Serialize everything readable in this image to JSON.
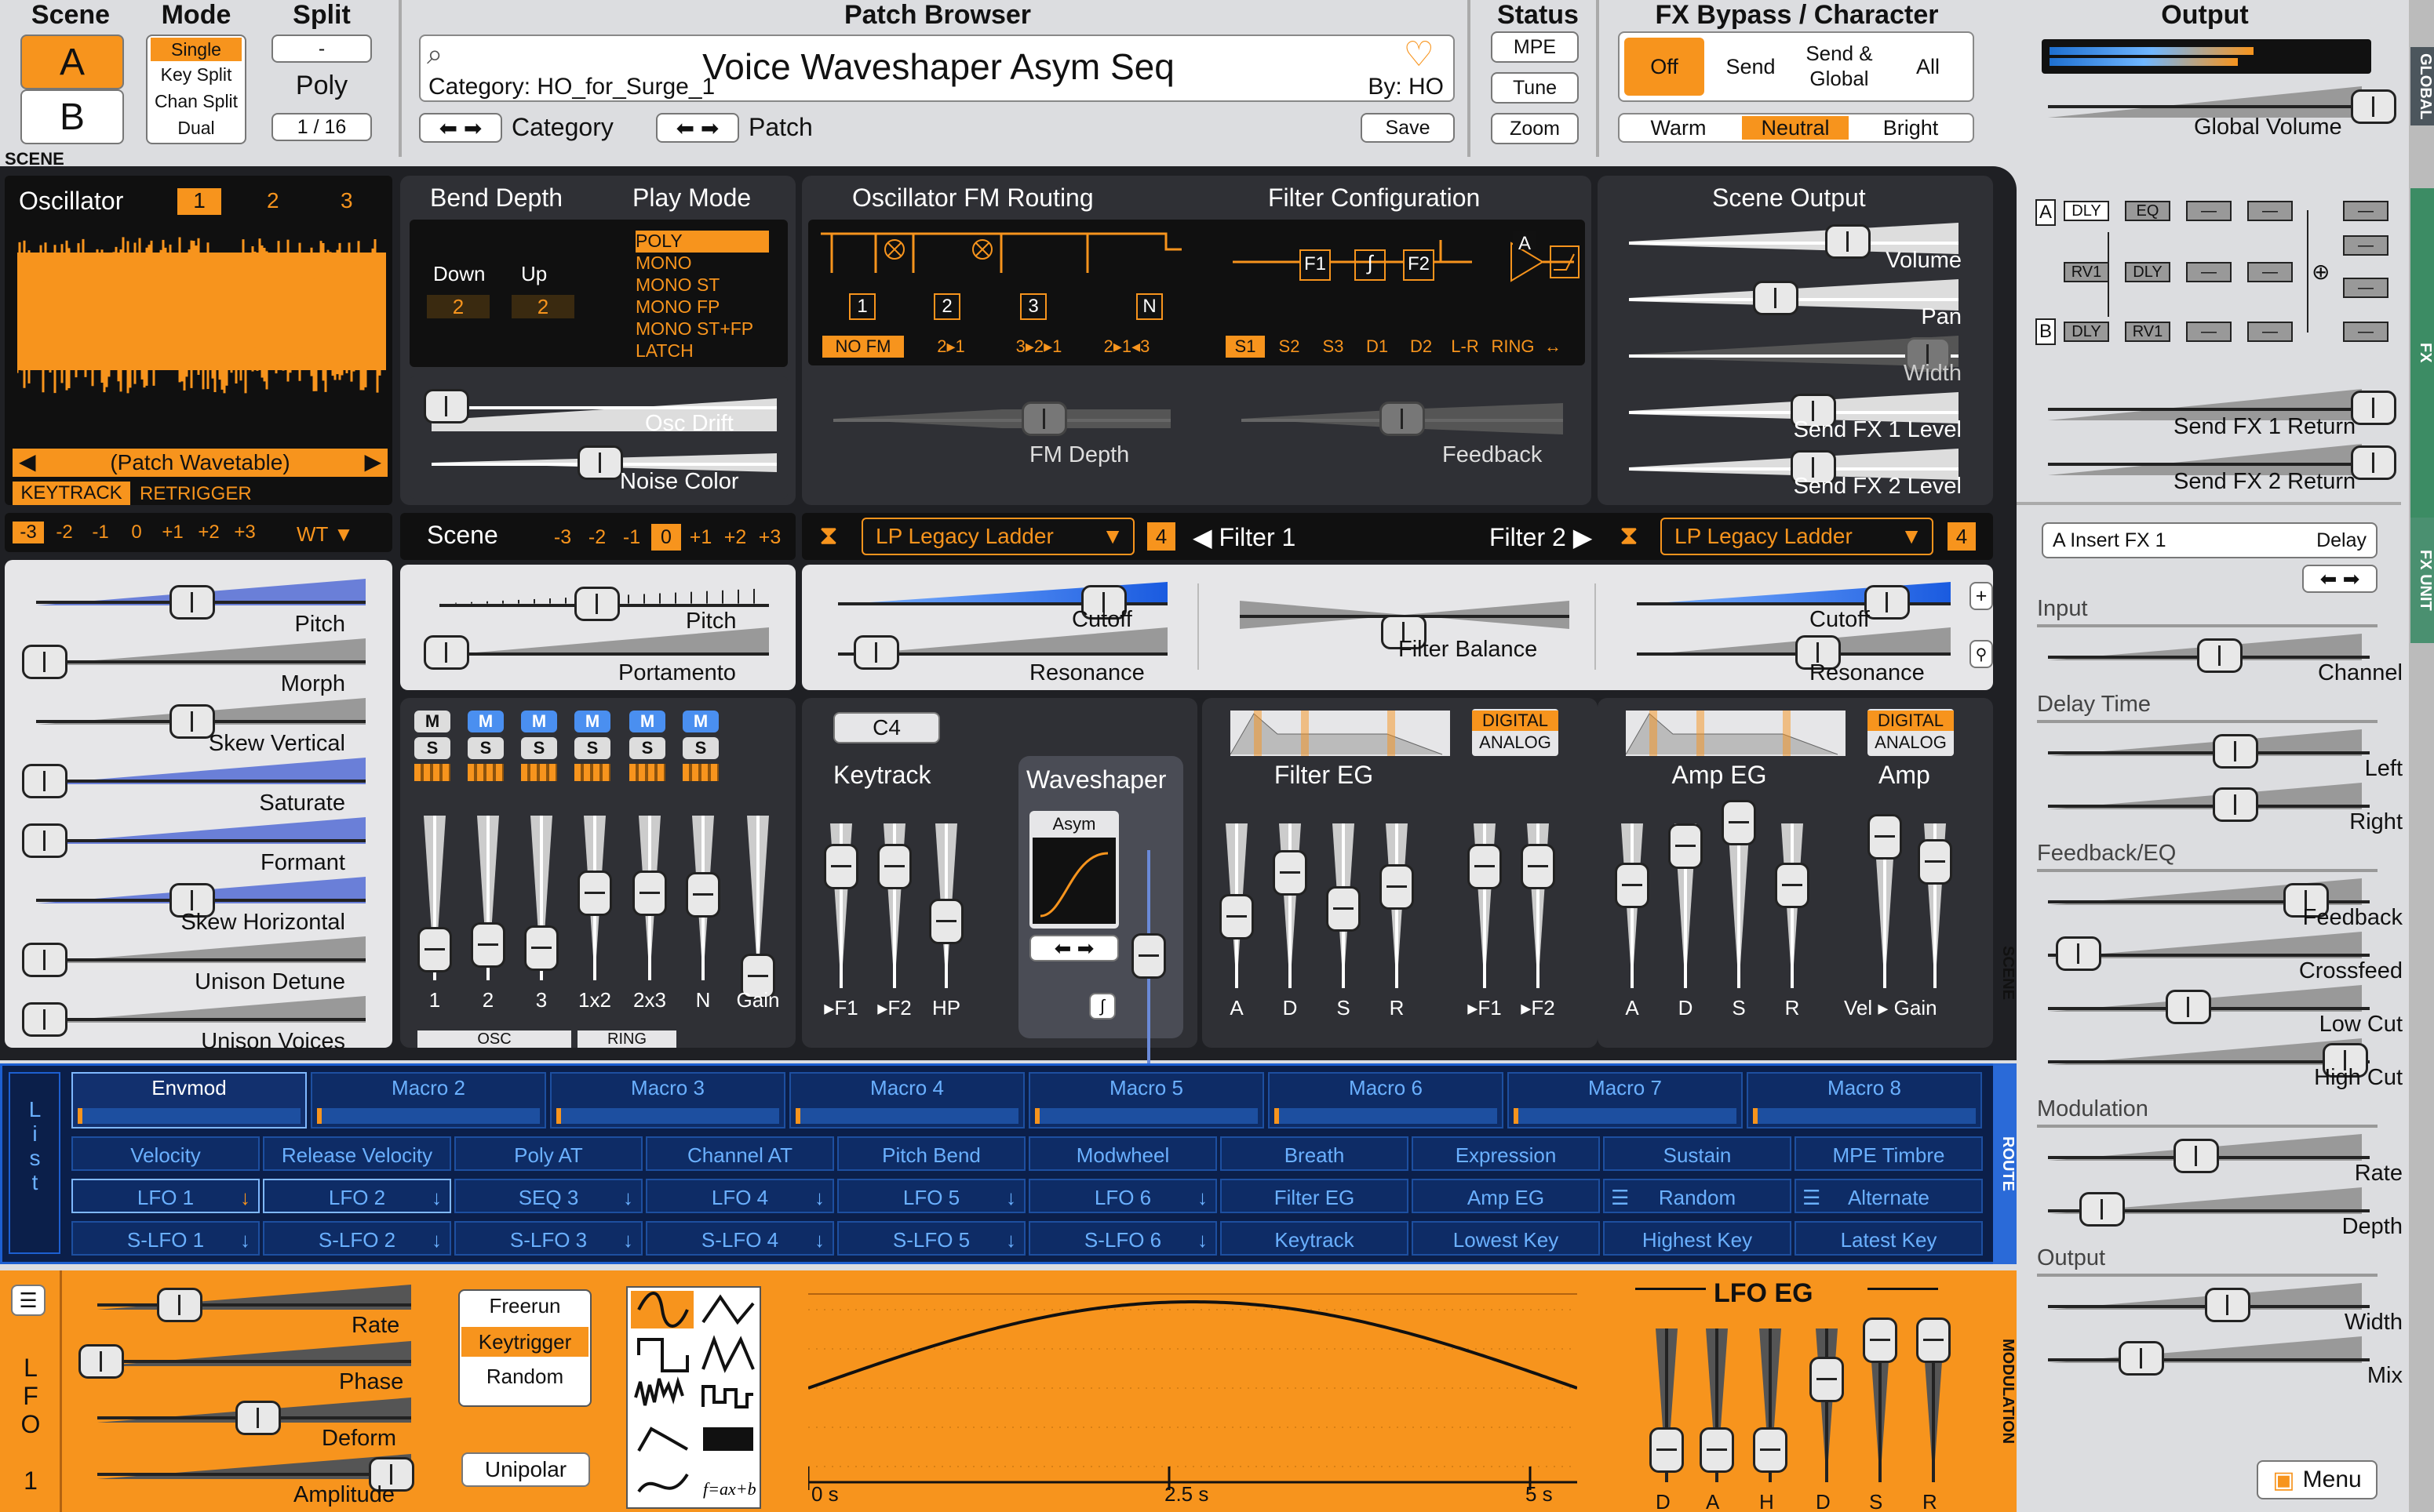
{
  "top": {
    "scene": {
      "title": "Scene",
      "a": "A",
      "b": "B"
    },
    "mode": {
      "title": "Mode",
      "options": [
        "Single",
        "Key Split",
        "Chan Split",
        "Dual"
      ],
      "selected": "Single"
    },
    "split": {
      "title": "Split",
      "value": "-",
      "poly_label": "Poly",
      "poly_value": "1 / 16"
    },
    "browser": {
      "title": "Patch Browser",
      "patch_name": "Voice Waveshaper Asym Seq",
      "category": "Category: HO_for_Surge_1",
      "author": "By: HO",
      "category_label": "Category",
      "patch_label": "Patch",
      "save": "Save"
    },
    "status": {
      "title": "Status",
      "mpe": "MPE",
      "tune": "Tune",
      "zoom": "Zoom"
    },
    "fx": {
      "title": "FX Bypass / Character",
      "off": "Off",
      "send": "Send",
      "send_global": "Send & Global",
      "all": "All",
      "warm": "Warm",
      "neutral": "Neutral",
      "bright": "Bright"
    },
    "output": {
      "title": "Output",
      "global_volume": "Global Volume"
    }
  },
  "scene_label": "SCENE",
  "osc": {
    "title": "Oscillator",
    "tabs": [
      "1",
      "2",
      "3"
    ],
    "wavetable": "(Patch Wavetable)",
    "keytrack": "KEYTRACK",
    "retrigger": "RETRIGGER",
    "octaves": [
      "-3",
      "-2",
      "-1",
      "0",
      "+1",
      "+2",
      "+3"
    ],
    "type": "WT",
    "params": [
      "Pitch",
      "Morph",
      "Skew Vertical",
      "Saturate",
      "Formant",
      "Skew Horizontal",
      "Unison Detune",
      "Unison Voices"
    ]
  },
  "bend": {
    "title": "Bend Depth",
    "down": "Down",
    "up": "Up",
    "down_val": "2",
    "up_val": "2"
  },
  "playmode": {
    "title": "Play Mode",
    "options": [
      "POLY",
      "MONO",
      "MONO ST",
      "MONO FP",
      "MONO ST+FP",
      "LATCH"
    ]
  },
  "drift": {
    "osc_drift": "Osc Drift",
    "noise_color": "Noise Color"
  },
  "fm": {
    "title": "Oscillator FM Routing",
    "nodes": [
      "1",
      "2",
      "3",
      "N"
    ],
    "options": [
      "NO FM",
      "2▸1",
      "3▸2▸1",
      "2▸1◂3"
    ],
    "depth": "FM Depth"
  },
  "filtercfg": {
    "title": "Filter Configuration",
    "options": [
      "S1",
      "S2",
      "S3",
      "D1",
      "D2",
      "L-R",
      "RING",
      "↔"
    ],
    "nodes": [
      "F1",
      "F2",
      "A"
    ],
    "feedback": "Feedback"
  },
  "sceneout": {
    "title": "Scene Output",
    "params": [
      "Volume",
      "Pan",
      "Width",
      "Send FX 1 Level",
      "Send FX 2 Level"
    ]
  },
  "scene2": {
    "title": "Scene",
    "octaves": [
      "-3",
      "-2",
      "-1",
      "0",
      "+1",
      "+2",
      "+3"
    ],
    "pitch": "Pitch",
    "portamento": "Portamento"
  },
  "filter": {
    "f1_type": "LP Legacy Ladder",
    "f2_type": "LP Legacy Ladder",
    "sub": "4",
    "f1": "◀ Filter 1",
    "f2": "Filter 2 ▶",
    "cutoff": "Cutoff",
    "resonance": "Resonance",
    "balance": "Filter Balance"
  },
  "mixer": {
    "m": "M",
    "s": "S",
    "labels": [
      "1",
      "2",
      "3",
      "1x2",
      "2x3",
      "N",
      "Gain"
    ],
    "osc": "OSC",
    "ring": "RING"
  },
  "keytrack": {
    "note": "C4",
    "title": "Keytrack",
    "labels": [
      "▸F1",
      "▸F2",
      "HP"
    ]
  },
  "waveshaper": {
    "title": "Waveshaper",
    "type": "Asym"
  },
  "fenv": {
    "title": "Filter EG",
    "digital": "DIGITAL",
    "analog": "ANALOG",
    "labels": [
      "A",
      "D",
      "S",
      "R",
      "▸F1",
      "▸F2"
    ]
  },
  "aenv": {
    "title": "Amp EG",
    "amp": "Amp",
    "digital": "DIGITAL",
    "analog": "ANALOG",
    "labels": [
      "A",
      "D",
      "S",
      "R",
      "Vel ▸ Gain"
    ]
  },
  "route": {
    "list": "List",
    "macros": [
      "Envmod",
      "Macro 2",
      "Macro 3",
      "Macro 4",
      "Macro 5",
      "Macro 6",
      "Macro 7",
      "Macro 8"
    ],
    "row1": [
      "Velocity",
      "Release Velocity",
      "Poly AT",
      "Channel AT",
      "Pitch Bend",
      "Modwheel",
      "Breath",
      "Expression",
      "Sustain",
      "MPE Timbre"
    ],
    "row2": [
      "LFO 1",
      "LFO 2",
      "SEQ 3",
      "LFO 4",
      "LFO 5",
      "LFO 6",
      "Filter EG",
      "Amp EG",
      "Random",
      "Alternate"
    ],
    "row3": [
      "S-LFO 1",
      "S-LFO 2",
      "S-LFO 3",
      "S-LFO 4",
      "S-LFO 5",
      "S-LFO 6",
      "Keytrack",
      "Lowest Key",
      "Highest Key",
      "Latest Key"
    ],
    "tab": "ROUTE"
  },
  "lfo": {
    "side": "LFO 1",
    "params": [
      "Rate",
      "Phase",
      "Deform",
      "Amplitude"
    ],
    "trig": [
      "Freerun",
      "Keytrigger",
      "Random"
    ],
    "unipolar": "Unipolar",
    "formula": "f=ax+b",
    "time": [
      "0 s",
      "2.5 s",
      "5 s"
    ],
    "eg": "LFO EG",
    "eg_labels": [
      "D",
      "A",
      "H",
      "D",
      "S",
      "R"
    ],
    "tab": "MODULATION"
  },
  "fxpanel": {
    "a": "A",
    "b": "B",
    "dly": "DLY",
    "eq": "EQ",
    "rv1": "RV1",
    "dash": "—",
    "send1": "Send FX 1 Return",
    "send2": "Send FX 2 Return",
    "slot": "A Insert FX 1",
    "type": "Delay",
    "groups": [
      {
        "name": "Input",
        "params": [
          "Channel"
        ]
      },
      {
        "name": "Delay Time",
        "params": [
          "Left",
          "Right"
        ]
      },
      {
        "name": "Feedback/EQ",
        "params": [
          "Feedback",
          "Crossfeed",
          "Low Cut",
          "High Cut"
        ]
      },
      {
        "name": "Modulation",
        "params": [
          "Rate",
          "Depth"
        ]
      },
      {
        "name": "Output",
        "params": [
          "Width",
          "Mix"
        ]
      }
    ],
    "menu": "Menu",
    "tabs": [
      "GLOBAL",
      "FX",
      "FX UNIT"
    ]
  },
  "colors": {
    "accent": "#f7941d",
    "dark": "#2f3035",
    "blue": "#1d4fa0"
  }
}
